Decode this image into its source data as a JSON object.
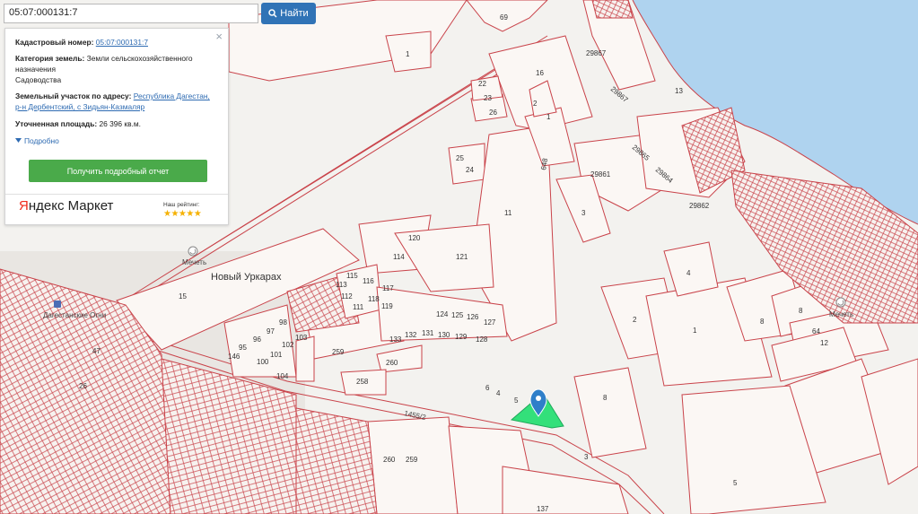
{
  "search": {
    "value": "05:07:000131:7",
    "button_label": "Найти"
  },
  "info": {
    "cadastral_label": "Кадастровый номер:",
    "cadastral_value": "05:07:000131:7",
    "category_label": "Категория земель:",
    "category_value": "Земли сельскохозяйственного назначения",
    "usage_value": "Садоводства",
    "address_label": "Земельный участок по адресу:",
    "address_line1": "Республика Дагестан,",
    "address_line2": "р-н Дербентский, с Зидьян-Казмаляр",
    "area_label": "Уточненная площадь:",
    "area_value": "26 396 кв.м.",
    "details_label": "Подробно",
    "report_button": "Получить подробный отчет",
    "close_glyph": "×"
  },
  "ad": {
    "brand_red": "Я",
    "brand_rest": "ндекс Маркет",
    "rating_label": "Наш рейтинг:",
    "stars": "★★★★★"
  },
  "map": {
    "places": {
      "village": "Новый Уркарах",
      "mosque1": "Мечеть",
      "mosque2": "Мечеть",
      "station": "Дагестанские Огни"
    },
    "road_label": "1455/2",
    "plot_numbers": {
      "n69": "69",
      "n1a": "1",
      "n16": "16",
      "n22": "22",
      "n23": "23",
      "n26": "26",
      "n2a": "2",
      "n1b": "1",
      "n25": "25",
      "n24": "24",
      "n13": "13",
      "n29867a": "29867",
      "n29867b": "29867",
      "n29865": "29865",
      "n29864": "29864",
      "n29861": "29861",
      "n29862": "29862",
      "n648": "648",
      "n11": "11",
      "n3a": "3",
      "n120": "120",
      "n114": "114",
      "n121": "121",
      "n15": "15",
      "n115": "115",
      "n116": "116",
      "n117": "117",
      "n113": "113",
      "n112": "112",
      "n118": "118",
      "n111": "111",
      "n119": "119",
      "n98": "98",
      "n97": "97",
      "n103": "103",
      "n95": "95",
      "n96": "96",
      "n102": "102",
      "n146": "146",
      "n100": "100",
      "n101": "101",
      "n104": "104",
      "n259a": "259",
      "n260a": "260",
      "n258": "258",
      "n133": "133",
      "n132": "132",
      "n131": "131",
      "n130": "130",
      "n129": "129",
      "n128": "128",
      "n127": "127",
      "n126": "126",
      "n125": "125",
      "n124": "124",
      "n4a": "4",
      "n2b": "2",
      "n1c": "1",
      "n8a": "8",
      "n8b": "8",
      "n8c": "8",
      "n64": "64",
      "n12": "12",
      "n6": "6",
      "n4b": "4",
      "n5a": "5",
      "n47": "47",
      "n26b": "26",
      "n260b": "260",
      "n259b": "259",
      "n137": "137",
      "n3b": "3",
      "n5b": "5"
    },
    "colors": {
      "selected_plot": "#33e07a",
      "marker": "#2f7fc9",
      "sea": "#afd3ef",
      "boundary": "#c9434a"
    }
  }
}
